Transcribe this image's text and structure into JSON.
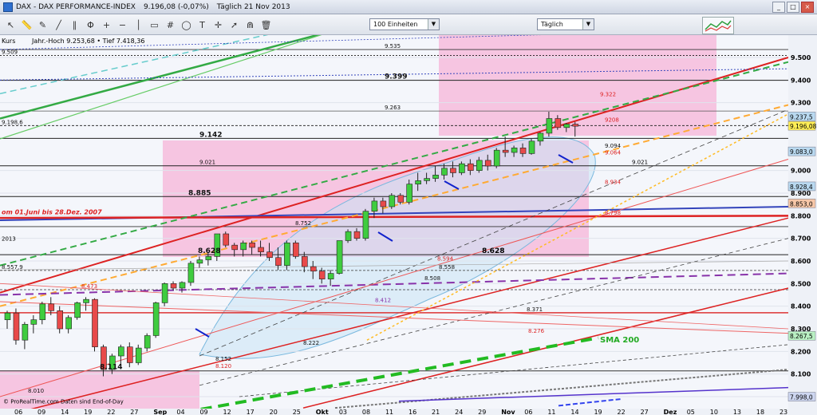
{
  "window": {
    "title": "DAX - DAX PERFORMANCE-INDEX",
    "quote": "9.196,08 (-0,07%)",
    "period_date": "Täglich 21 Nov 2013",
    "buttons": {
      "minimize": "_",
      "restore": "□",
      "close": "×"
    }
  },
  "toolbar": {
    "icons": [
      "cursor-icon",
      "ruler-icon",
      "pencil-icon",
      "trendline-icon",
      "channel-icon",
      "fibonacci-icon",
      "zoom-in-icon",
      "zoom-out-icon",
      "vertical-line-icon",
      "rectangle-icon",
      "grid-icon",
      "ellipse-icon",
      "text-icon",
      "crosshair-icon",
      "arrow-icon",
      "magnet-icon",
      "trash-icon"
    ],
    "units_select": "100 Einheiten",
    "period_select": "Täglich"
  },
  "chart": {
    "header_label": "Kurs",
    "high_low": "Jahr.-Hoch 9.253,68 • Tief 7.418,36",
    "price_axis": [
      {
        "v": 9500,
        "t": "9.500"
      },
      {
        "v": 9400,
        "t": "9.400"
      },
      {
        "v": 9300,
        "t": "9.300"
      },
      {
        "v": 9000,
        "t": "9.000"
      },
      {
        "v": 8900,
        "t": "8.900"
      },
      {
        "v": 8800,
        "t": "8.800"
      },
      {
        "v": 8700,
        "t": "8.700"
      },
      {
        "v": 8600,
        "t": "8.600"
      },
      {
        "v": 8500,
        "t": "8.500"
      },
      {
        "v": 8400,
        "t": "8.400"
      },
      {
        "v": 8300,
        "t": "8.300"
      },
      {
        "v": 8200,
        "t": "8.200"
      },
      {
        "v": 8100,
        "t": "8.100"
      },
      {
        "v": 8000,
        "t": "8.000"
      }
    ],
    "price_markers": [
      {
        "v": 9237.5,
        "t": "9.237,5",
        "color": "#b9d9f0"
      },
      {
        "v": 9196.08,
        "t": "9.196,08",
        "color": "#ffee55"
      },
      {
        "v": 9083,
        "t": "9.083,0",
        "color": "#b9d9f0"
      },
      {
        "v": 8928.4,
        "t": "8.928,4",
        "color": "#b9d9f0"
      },
      {
        "v": 8853,
        "t": "8.853,0",
        "color": "#f7c7a8"
      },
      {
        "v": 8267.5,
        "t": "8.267,5",
        "color": "#b9f0c3"
      },
      {
        "v": 7998,
        "t": "7.998,0",
        "color": "#cdd6f0"
      }
    ],
    "x_axis": [
      "06",
      "09",
      "14",
      "19",
      "22",
      "27",
      "Sep",
      "04",
      "09",
      "12",
      "17",
      "20",
      "25",
      "Okt",
      "03",
      "08",
      "11",
      "16",
      "21",
      "24",
      "29",
      "Nov",
      "06",
      "11",
      "14",
      "19",
      "22",
      "27",
      "Dez",
      "05",
      "10",
      "13",
      "18",
      "23"
    ],
    "level_labels": [
      {
        "v": 9509,
        "t": "9.509"
      },
      {
        "v": 9535,
        "t": "9.535"
      },
      {
        "v": 9399,
        "t": "9.399"
      },
      {
        "v": 9263,
        "t": "9.263"
      },
      {
        "v": 9322,
        "t": "9.322"
      },
      {
        "v": 9198.6,
        "t": "9.198,6"
      },
      {
        "v": 9142,
        "t": "9.142"
      },
      {
        "v": 9021,
        "t": "9.021"
      },
      {
        "v": 8885,
        "t": "8.885"
      },
      {
        "v": 8752,
        "t": "8.752"
      },
      {
        "v": 8628,
        "t": "8.628"
      },
      {
        "v": 8594,
        "t": "8.594"
      },
      {
        "v": 8558,
        "t": "8.558"
      },
      {
        "v": 8557.9,
        "t": "8.557,9"
      },
      {
        "v": 8508,
        "t": "8.508"
      },
      {
        "v": 8473,
        "t": "8.473"
      },
      {
        "v": 8412,
        "t": "8.412"
      },
      {
        "v": 8371,
        "t": "8.371"
      },
      {
        "v": 8276,
        "t": "8.276"
      },
      {
        "v": 8222,
        "t": "8.222"
      },
      {
        "v": 8152,
        "t": "8.152"
      },
      {
        "v": 8120,
        "t": "8.120"
      },
      {
        "v": 8114,
        "t": "8.114"
      },
      {
        "v": 8010,
        "t": "8.010"
      },
      {
        "v": 9094,
        "t": "9.094"
      },
      {
        "v": 9064,
        "t": "9.064"
      },
      {
        "v": 8934,
        "t": "8.934"
      },
      {
        "v": 8798,
        "t": "8.798"
      },
      {
        "v": 9208,
        "t": "9208"
      }
    ],
    "annotations": {
      "range_label": "om 01.Juni bis 28.Dez. 2007",
      "sma_label": "SMA 200",
      "year_label": "2013",
      "footer": "© ProRealTime.com Daten sind End-of-Day"
    },
    "ohlc": [
      [
        8340,
        8380,
        8300,
        8370
      ],
      [
        8370,
        8390,
        8230,
        8250
      ],
      [
        8250,
        8330,
        8210,
        8320
      ],
      [
        8320,
        8360,
        8280,
        8340
      ],
      [
        8340,
        8420,
        8320,
        8410
      ],
      [
        8410,
        8440,
        8360,
        8380
      ],
      [
        8380,
        8400,
        8280,
        8300
      ],
      [
        8300,
        8360,
        8280,
        8350
      ],
      [
        8350,
        8420,
        8340,
        8415
      ],
      [
        8415,
        8440,
        8380,
        8430
      ],
      [
        8430,
        8435,
        8200,
        8220
      ],
      [
        8220,
        8230,
        8090,
        8120
      ],
      [
        8120,
        8190,
        8100,
        8180
      ],
      [
        8180,
        8230,
        8140,
        8220
      ],
      [
        8220,
        8240,
        8130,
        8150
      ],
      [
        8150,
        8230,
        8140,
        8215
      ],
      [
        8215,
        8280,
        8200,
        8270
      ],
      [
        8270,
        8420,
        8260,
        8415
      ],
      [
        8415,
        8505,
        8400,
        8500
      ],
      [
        8500,
        8510,
        8470,
        8480
      ],
      [
        8480,
        8510,
        8460,
        8505
      ],
      [
        8505,
        8600,
        8490,
        8590
      ],
      [
        8590,
        8620,
        8570,
        8605
      ],
      [
        8605,
        8640,
        8580,
        8620
      ],
      [
        8620,
        8720,
        8600,
        8720
      ],
      [
        8720,
        8730,
        8660,
        8670
      ],
      [
        8670,
        8680,
        8620,
        8650
      ],
      [
        8650,
        8690,
        8620,
        8680
      ],
      [
        8680,
        8690,
        8630,
        8660
      ],
      [
        8660,
        8690,
        8620,
        8640
      ],
      [
        8640,
        8680,
        8600,
        8615
      ],
      [
        8615,
        8660,
        8560,
        8580
      ],
      [
        8580,
        8690,
        8560,
        8680
      ],
      [
        8680,
        8690,
        8610,
        8620
      ],
      [
        8620,
        8640,
        8550,
        8575
      ],
      [
        8575,
        8600,
        8520,
        8555
      ],
      [
        8555,
        8570,
        8500,
        8520
      ],
      [
        8520,
        8560,
        8490,
        8545
      ],
      [
        8545,
        8690,
        8540,
        8690
      ],
      [
        8690,
        8740,
        8680,
        8730
      ],
      [
        8730,
        8745,
        8690,
        8700
      ],
      [
        8700,
        8830,
        8690,
        8820
      ],
      [
        8820,
        8880,
        8790,
        8865
      ],
      [
        8865,
        8880,
        8810,
        8840
      ],
      [
        8840,
        8900,
        8830,
        8890
      ],
      [
        8890,
        8900,
        8850,
        8860
      ],
      [
        8860,
        8960,
        8850,
        8940
      ],
      [
        8940,
        8990,
        8910,
        8955
      ],
      [
        8955,
        8990,
        8940,
        8965
      ],
      [
        8965,
        9020,
        8950,
        8980
      ],
      [
        8980,
        9030,
        8960,
        9010
      ],
      [
        9010,
        9040,
        8970,
        8990
      ],
      [
        8990,
        9040,
        8980,
        9030
      ],
      [
        9030,
        9050,
        8980,
        9000
      ],
      [
        9000,
        9060,
        8990,
        9045
      ],
      [
        9045,
        9070,
        9000,
        9020
      ],
      [
        9020,
        9100,
        9010,
        9090
      ],
      [
        9090,
        9150,
        9060,
        9080
      ],
      [
        9080,
        9110,
        9060,
        9100
      ],
      [
        9100,
        9120,
        9060,
        9075
      ],
      [
        9075,
        9140,
        9070,
        9130
      ],
      [
        9130,
        9170,
        9110,
        9165
      ],
      [
        9165,
        9260,
        9150,
        9230
      ],
      [
        9230,
        9245,
        9180,
        9190
      ],
      [
        9190,
        9210,
        9170,
        9205
      ],
      [
        9205,
        9215,
        9150,
        9196
      ]
    ]
  }
}
